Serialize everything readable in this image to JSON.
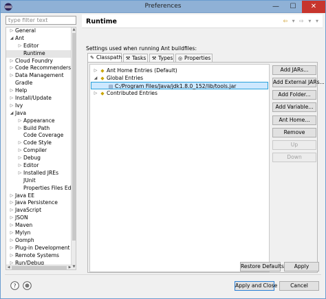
{
  "window": {
    "title": "Preferences"
  },
  "titlebar": {
    "minimize": "—",
    "maximize": "☐",
    "close": "✕"
  },
  "filter": {
    "placeholder": "type filter text",
    "value": ""
  },
  "nav_tree": [
    {
      "label": "General",
      "level": 0,
      "toggle": "▷"
    },
    {
      "label": "Ant",
      "level": 0,
      "toggle": "◢"
    },
    {
      "label": "Editor",
      "level": 1,
      "toggle": "▷"
    },
    {
      "label": "Runtime",
      "level": 1,
      "toggle": "",
      "selected": true
    },
    {
      "label": "Cloud Foundry",
      "level": 0,
      "toggle": "▷"
    },
    {
      "label": "Code Recommenders",
      "level": 0,
      "toggle": "▷"
    },
    {
      "label": "Data Management",
      "level": 0,
      "toggle": "▷"
    },
    {
      "label": "Gradle",
      "level": 0,
      "toggle": ""
    },
    {
      "label": "Help",
      "level": 0,
      "toggle": "▷"
    },
    {
      "label": "Install/Update",
      "level": 0,
      "toggle": "▷"
    },
    {
      "label": "Ivy",
      "level": 0,
      "toggle": "▷"
    },
    {
      "label": "Java",
      "level": 0,
      "toggle": "◢"
    },
    {
      "label": "Appearance",
      "level": 1,
      "toggle": "▷"
    },
    {
      "label": "Build Path",
      "level": 1,
      "toggle": "▷"
    },
    {
      "label": "Code Coverage",
      "level": 1,
      "toggle": ""
    },
    {
      "label": "Code Style",
      "level": 1,
      "toggle": "▷"
    },
    {
      "label": "Compiler",
      "level": 1,
      "toggle": "▷"
    },
    {
      "label": "Debug",
      "level": 1,
      "toggle": "▷"
    },
    {
      "label": "Editor",
      "level": 1,
      "toggle": "▷"
    },
    {
      "label": "Installed JREs",
      "level": 1,
      "toggle": "▷"
    },
    {
      "label": "JUnit",
      "level": 1,
      "toggle": ""
    },
    {
      "label": "Properties Files Editor",
      "level": 1,
      "toggle": ""
    },
    {
      "label": "Java EE",
      "level": 0,
      "toggle": "▷"
    },
    {
      "label": "Java Persistence",
      "level": 0,
      "toggle": "▷"
    },
    {
      "label": "JavaScript",
      "level": 0,
      "toggle": "▷"
    },
    {
      "label": "JSON",
      "level": 0,
      "toggle": "▷"
    },
    {
      "label": "Maven",
      "level": 0,
      "toggle": "▷"
    },
    {
      "label": "Mylyn",
      "level": 0,
      "toggle": "▷"
    },
    {
      "label": "Oomph",
      "level": 0,
      "toggle": "▷"
    },
    {
      "label": "Plug-in Development",
      "level": 0,
      "toggle": "▷"
    },
    {
      "label": "Remote Systems",
      "level": 0,
      "toggle": "▷"
    },
    {
      "label": "Run/Debug",
      "level": 0,
      "toggle": "▷"
    }
  ],
  "page": {
    "title": "Runtime",
    "subtitle": "Settings used when running Ant buildfiles:",
    "nav": {
      "back": "⇦",
      "back_menu": "▾",
      "forward": "⇨",
      "forward_menu": "▾",
      "menu": "▾"
    }
  },
  "tabs": [
    {
      "label": "Classpath",
      "icon": "✎",
      "active": true
    },
    {
      "label": "Tasks",
      "icon": "⚒",
      "active": false
    },
    {
      "label": "Types",
      "icon": "⚒",
      "active": false
    },
    {
      "label": "Properties",
      "icon": "◎",
      "active": false
    }
  ],
  "classpath_entries": [
    {
      "label": "Ant Home Entries (Default)",
      "toggle": "▷",
      "icon": "◆",
      "level": 0
    },
    {
      "label": "Global Entries",
      "toggle": "◢",
      "icon": "◆",
      "level": 0
    },
    {
      "label": "C:/Program Files/Java/jdk1.8.0_152/lib/tools.jar",
      "toggle": "",
      "icon": "▤",
      "level": 1,
      "selected": true
    },
    {
      "label": "Contributed Entries",
      "toggle": "▷",
      "icon": "◆",
      "level": 0
    }
  ],
  "side_buttons": [
    {
      "label": "Add JARs...",
      "enabled": true
    },
    {
      "label": "Add External JARs...",
      "enabled": true
    },
    {
      "label": "Add Folder...",
      "enabled": true
    },
    {
      "label": "Add Variable...",
      "enabled": true
    },
    {
      "label": "Ant Home...",
      "enabled": true
    },
    {
      "label": "Remove",
      "enabled": true
    },
    {
      "label": "Up",
      "enabled": false
    },
    {
      "label": "Down",
      "enabled": false
    }
  ],
  "page_buttons": {
    "restore_defaults": "Restore Defaults",
    "apply": "Apply"
  },
  "dialog_buttons": {
    "apply_and_close": "Apply and Close",
    "cancel": "Cancel"
  },
  "icons": {
    "help": "help-icon",
    "import_export": "import-export-icon"
  },
  "colors": {
    "titlebar": "#8fb1d6",
    "close": "#c7352d",
    "selection": "#cde8ff",
    "selection_border": "#26a0da"
  }
}
